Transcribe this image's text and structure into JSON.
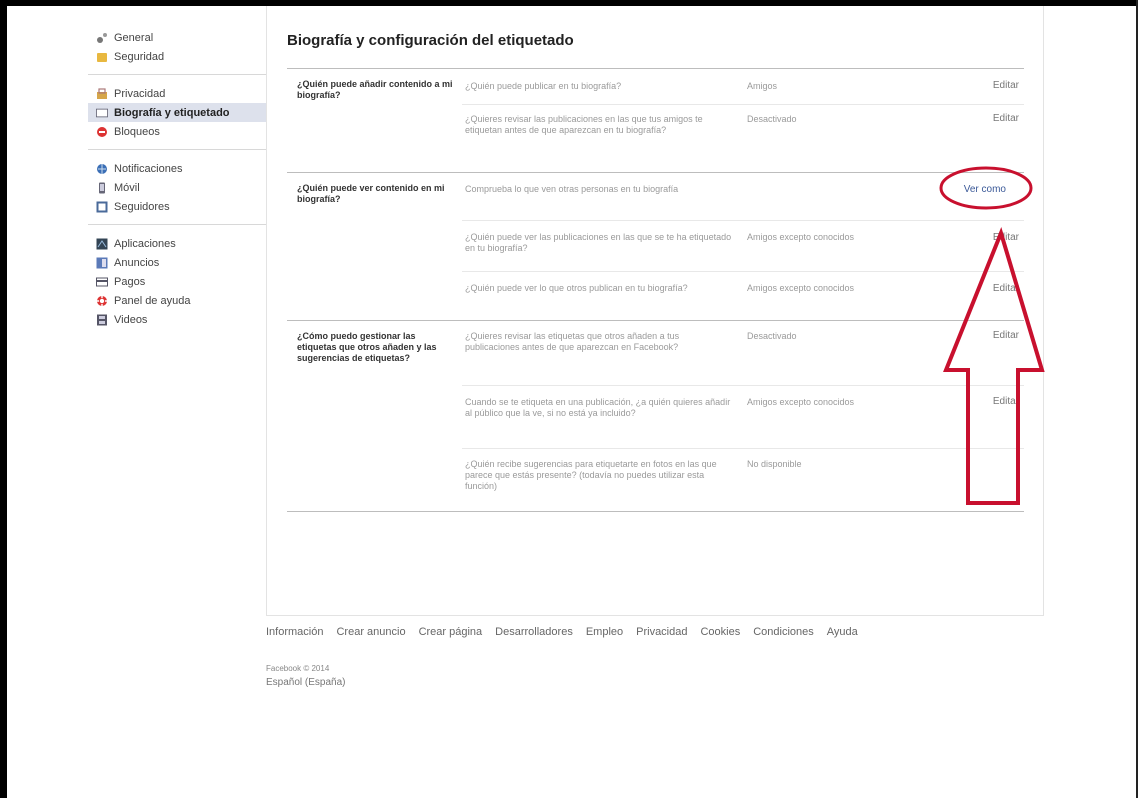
{
  "sidebar": {
    "groups": [
      [
        {
          "label": "General",
          "icon": "gear-icon"
        },
        {
          "label": "Seguridad",
          "icon": "shield-icon"
        }
      ],
      [
        {
          "label": "Privacidad",
          "icon": "lock-icon"
        },
        {
          "label": "Biografía y etiquetado",
          "icon": "timeline-icon"
        },
        {
          "label": "Bloqueos",
          "icon": "block-icon"
        }
      ],
      [
        {
          "label": "Notificaciones",
          "icon": "globe-icon"
        },
        {
          "label": "Móvil",
          "icon": "mobile-icon"
        },
        {
          "label": "Seguidores",
          "icon": "rss-icon"
        }
      ],
      [
        {
          "label": "Aplicaciones",
          "icon": "apps-icon"
        },
        {
          "label": "Anuncios",
          "icon": "ads-icon"
        },
        {
          "label": "Pagos",
          "icon": "card-icon"
        },
        {
          "label": "Panel de ayuda",
          "icon": "lifebuoy-icon"
        },
        {
          "label": "Videos",
          "icon": "film-icon"
        }
      ]
    ]
  },
  "main": {
    "title": "Biografía y configuración del etiquetado",
    "sections": [
      {
        "label": "¿Quién puede añadir contenido a mi biografía?",
        "rows": [
          {
            "question": "¿Quién puede publicar en tu biografía?",
            "value": "Amigos",
            "action": "Editar"
          },
          {
            "question": "¿Quieres revisar las publicaciones en las que tus amigos te etiquetan antes de que aparezcan en tu biografía?",
            "value": "Desactivado",
            "action": "Editar"
          }
        ]
      },
      {
        "label": "¿Quién puede ver contenido en mi biografía?",
        "rows": [
          {
            "question": "Comprueba lo que ven otras personas en tu biografía",
            "value": "",
            "action": "Ver como"
          },
          {
            "question": "¿Quién puede ver las publicaciones en las que se te ha etiquetado en tu biografía?",
            "value": "Amigos excepto conocidos",
            "action": "Editar"
          },
          {
            "question": "¿Quién puede ver lo que otros publican en tu biografía?",
            "value": "Amigos excepto conocidos",
            "action": "Editar"
          }
        ]
      },
      {
        "label": "¿Cómo puedo gestionar las etiquetas que otros añaden y las sugerencias de etiquetas?",
        "rows": [
          {
            "question": "¿Quieres revisar las etiquetas que otros añaden a tus publicaciones antes de que aparezcan en Facebook?",
            "value": "Desactivado",
            "action": "Editar"
          },
          {
            "question": "Cuando se te etiqueta en una publicación, ¿a quién quieres añadir al público que la ve, si no está ya incluido?",
            "value": "Amigos excepto conocidos",
            "action": "Editar"
          },
          {
            "question": "¿Quién recibe sugerencias para etiquetarte en fotos en las que parece que estás presente? (todavía no puedes utilizar esta función)",
            "value": "No disponible",
            "action": ""
          }
        ]
      }
    ]
  },
  "footer": {
    "links": [
      "Información",
      "Crear anuncio",
      "Crear página",
      "Desarrolladores",
      "Empleo",
      "Privacidad",
      "Cookies",
      "Condiciones",
      "Ayuda"
    ],
    "copyright": "Facebook © 2014",
    "language": "Español (España)"
  },
  "colors": {
    "annotation": "#c8102e",
    "active_bg": "#dde1ec"
  }
}
